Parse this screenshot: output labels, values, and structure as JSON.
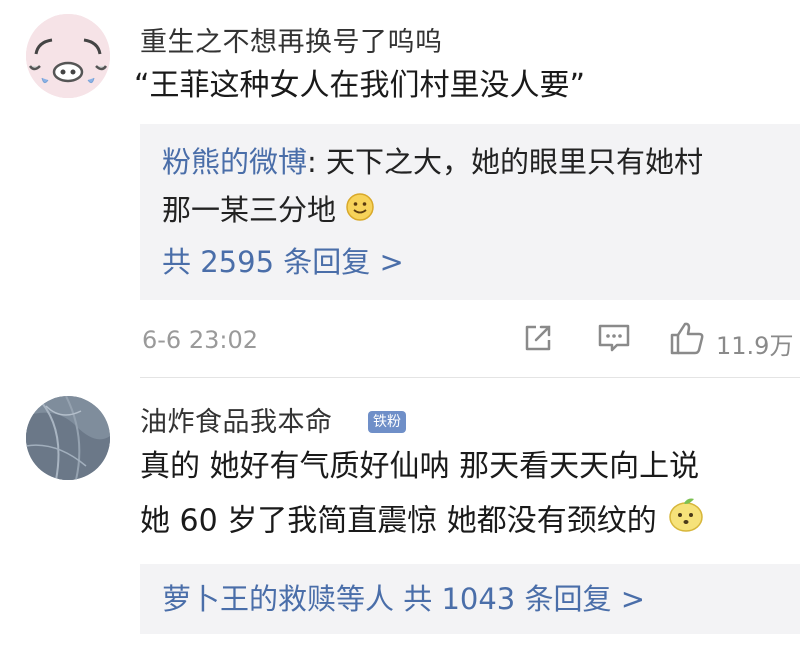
{
  "comment1": {
    "username": "重生之不想再换号了呜呜",
    "text": "“王菲这种女人在我们村里没人要”",
    "reply": {
      "author": "粉熊的微博",
      "text_line1": ": 天下之大，她的眼里只有她村",
      "text_line2": "那一某三分地",
      "emoji": "smile-emoji",
      "more": "共 2595 条回复 >"
    },
    "time": "6-6 23:02",
    "like_count": "11.9万"
  },
  "comment2": {
    "username": "油炸食品我本命",
    "badge": "铁粉",
    "text_line1": "真的 她好有气质好仙呐 那天看天天向上说",
    "text_line2": "她 60 岁了我简直震惊 她都没有颈纹的",
    "emoji": "lemon-emoji",
    "reply": {
      "authors": "萝卜王的救赎等人",
      "more": "共 1043 条回复 >"
    }
  }
}
